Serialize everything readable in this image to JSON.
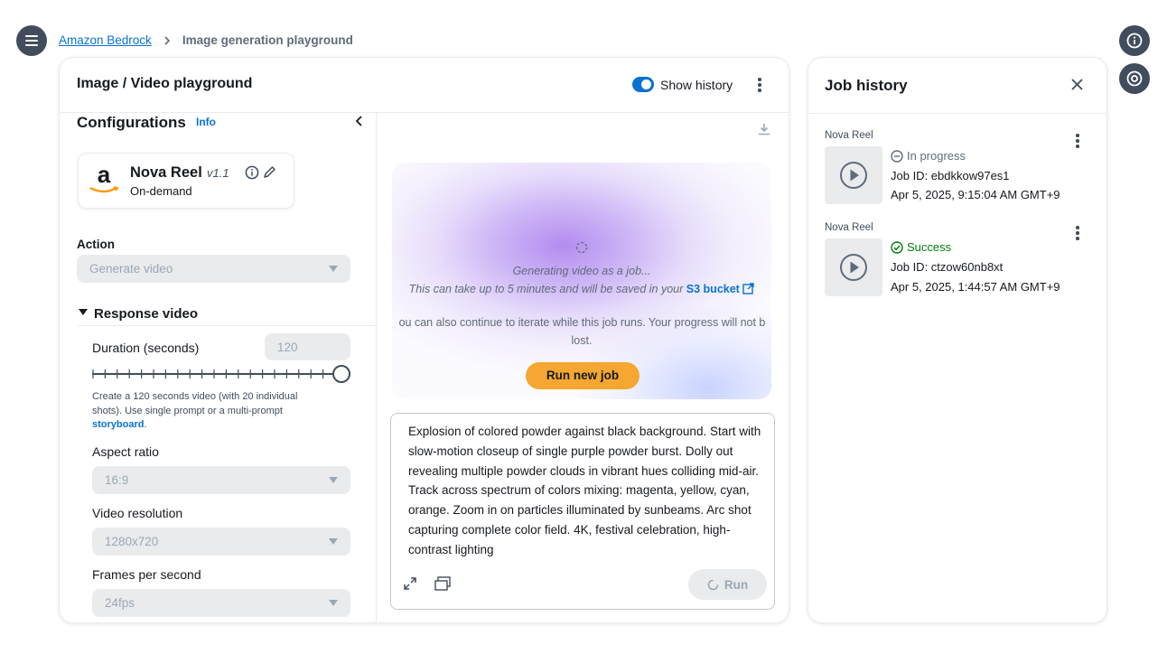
{
  "breadcrumb": {
    "root": "Amazon Bedrock",
    "current": "Image generation playground"
  },
  "playground": {
    "title": "Image / Video playground",
    "show_history_label": "Show history",
    "show_history_on": true
  },
  "config": {
    "title": "Configurations",
    "info_link": "Info",
    "model": {
      "name": "Nova Reel",
      "version": "v1.1",
      "mode": "On-demand",
      "logo_letter": "a"
    },
    "action": {
      "label": "Action",
      "value": "Generate video"
    },
    "response_section": "Response video",
    "duration": {
      "label": "Duration (seconds)",
      "value": "120",
      "slider_fraction": 1.0
    },
    "duration_help": "Create a 120 seconds video (with 20 individual shots). Use single prompt or a multi-prompt",
    "duration_help_link": "storyboard",
    "aspect": {
      "label": "Aspect ratio",
      "value": "16:9"
    },
    "resolution": {
      "label": "Video resolution",
      "value": "1280x720"
    },
    "fps": {
      "label": "Frames per second",
      "value": "24fps"
    }
  },
  "canvas": {
    "status_line1": "Generating video as a job...",
    "status_line2": "This can take up to 5 minutes and will be saved in your",
    "s3_link": "S3 bucket",
    "iterate_line1": "ou can also continue to iterate while this job runs. Your progress will not b",
    "iterate_line2": "lost.",
    "run_new_job": "Run new job"
  },
  "prompt": {
    "text": "Explosion of colored powder against black background. Start with slow-motion closeup of single purple powder burst. Dolly out revealing multiple powder clouds in vibrant hues colliding mid-air. Track across spectrum of colors mixing: magenta, yellow, cyan, orange. Zoom in on particles illuminated by sunbeams. Arc shot capturing complete color field. 4K, festival celebration, high-contrast lighting",
    "run_label": "Run"
  },
  "history": {
    "title": "Job history",
    "jobs": [
      {
        "model": "Nova Reel",
        "status": "In progress",
        "job_id": "Job ID: ebdkkow97es1",
        "time": "Apr 5, 2025, 9:15:04 AM GMT+9"
      },
      {
        "model": "Nova Reel",
        "status": "Success",
        "job_id": "Job ID: ctzow60nb8xt",
        "time": "Apr 5, 2025, 1:44:57 AM GMT+9"
      }
    ]
  },
  "colors": {
    "accent": "#0972d3",
    "run_button": "#f5a731",
    "success": "#037f0c",
    "dark": "#414d5c"
  },
  "icons": [
    "menu-icon",
    "info-icon",
    "feedback-icon",
    "kebab-icon",
    "chevron-left-icon",
    "download-icon",
    "edit-icon",
    "external-link-icon",
    "expand-icon",
    "image-stack-icon",
    "spinner-icon",
    "play-icon",
    "close-icon",
    "check-circle-icon",
    "minus-circle-icon"
  ]
}
